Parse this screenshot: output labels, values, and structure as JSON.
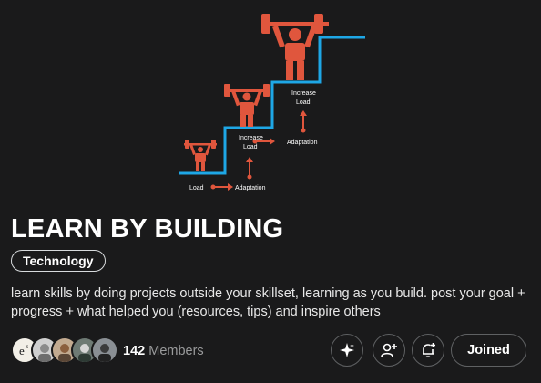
{
  "community": {
    "title": "LEARN BY BUILDING",
    "topic": "Technology",
    "description": "learn skills by doing projects outside your skillset, learning as you build. post your goal + progress + what helped you (resources, tips) and inspire others",
    "member_count": "142",
    "member_label": "Members"
  },
  "banner": {
    "labels": {
      "load": "Load",
      "adaptation_1": "Adaptation",
      "increase_load_1": [
        "Increase",
        "Load"
      ],
      "adaptation_2": "Adaptation",
      "increase_load_2": [
        "Increase",
        "Load"
      ]
    },
    "colors": {
      "lifter": "#e0563d",
      "step": "#1ea7e6"
    }
  },
  "actions": {
    "join_label": "Joined",
    "buttons": [
      "sparkle-icon",
      "add-user-icon",
      "notification-bell-icon"
    ]
  },
  "colors": {
    "background": "#1a1a1b",
    "border": "#5f6163",
    "muted": "#9a9b9c"
  }
}
